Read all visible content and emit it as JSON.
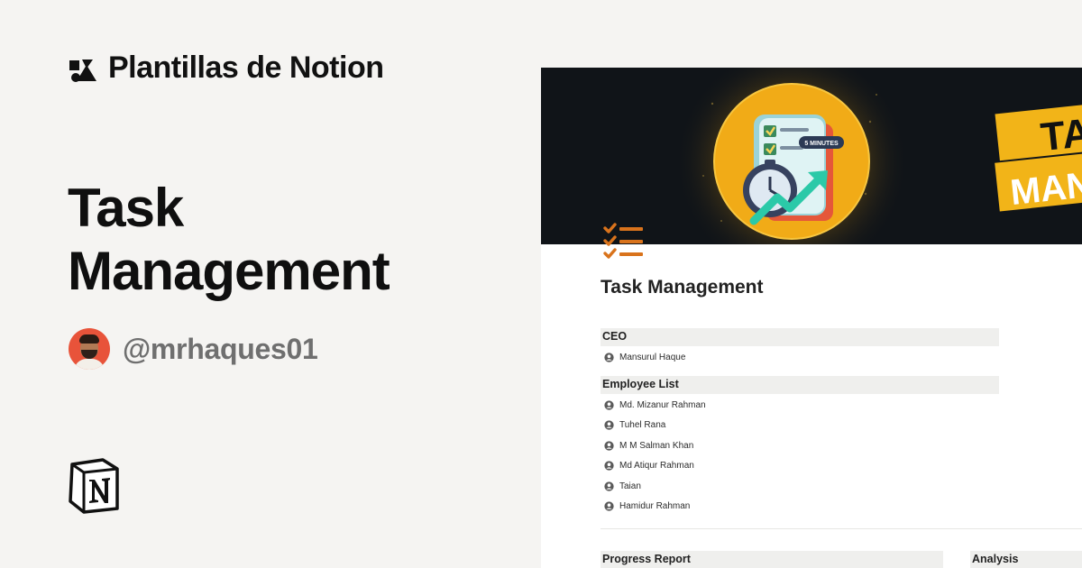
{
  "brand": {
    "name": "Plantillas de Notion"
  },
  "hero": {
    "title_line1": "Task",
    "title_line2": "Management"
  },
  "author": {
    "handle": "@mrhaques01"
  },
  "preview": {
    "cover": {
      "badge_text": "5 MINUTES",
      "banner_line1": "TA",
      "banner_line2": "MANA"
    },
    "page_title": "Task Management",
    "ceo": {
      "header": "CEO",
      "people": [
        "Mansurul Haque"
      ]
    },
    "employees": {
      "header": "Employee List",
      "people": [
        "Md. Mizanur Rahman",
        "Tuhel Rana",
        "M M Salman Khan",
        "Md Atiqur Rahman",
        "Taian",
        "Hamidur Rahman"
      ]
    },
    "bottom": {
      "progress_header": "Progress Report",
      "analysis_header": "Analysis"
    }
  },
  "colors": {
    "background": "#f5f4f2",
    "cover_dark": "#101418",
    "accent_yellow": "#f5b82e",
    "icon_orange": "#d9731c",
    "handle_gray": "#6f6f6f"
  },
  "icons": [
    "brand-logo-icon",
    "notion-logo-icon",
    "checklist-icon",
    "person-icon",
    "clock-icon",
    "trend-arrow-icon"
  ]
}
